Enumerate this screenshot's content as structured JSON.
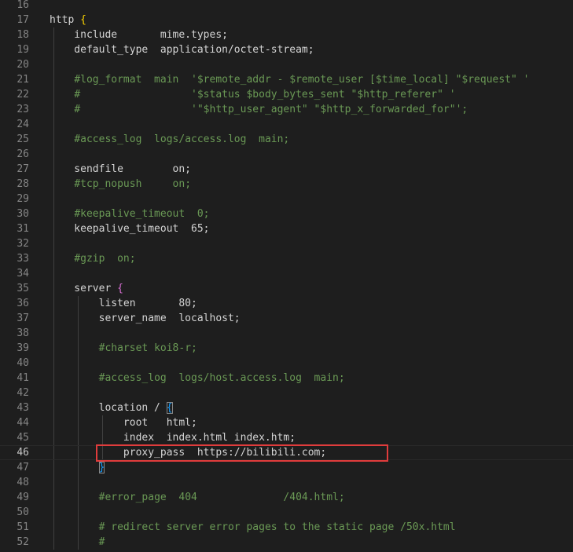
{
  "editor": {
    "lines": [
      {
        "n": "16",
        "segments": []
      },
      {
        "n": "17",
        "segments": [
          {
            "t": "http "
          },
          {
            "t": "{",
            "c": "brace-gold"
          }
        ]
      },
      {
        "n": "18",
        "segments": [
          {
            "t": "    include       mime.types;"
          }
        ]
      },
      {
        "n": "19",
        "segments": [
          {
            "t": "    default_type  application/octet-stream;"
          }
        ]
      },
      {
        "n": "20",
        "segments": []
      },
      {
        "n": "21",
        "segments": [
          {
            "t": "    "
          },
          {
            "t": "#log_format  main  '$remote_addr - $remote_user [$time_local] \"$request\" '",
            "c": "comment"
          }
        ]
      },
      {
        "n": "22",
        "segments": [
          {
            "t": "    "
          },
          {
            "t": "#                  '$status $body_bytes_sent \"$http_referer\" '",
            "c": "comment"
          }
        ]
      },
      {
        "n": "23",
        "segments": [
          {
            "t": "    "
          },
          {
            "t": "#                  '\"$http_user_agent\" \"$http_x_forwarded_for\"';",
            "c": "comment"
          }
        ]
      },
      {
        "n": "24",
        "segments": []
      },
      {
        "n": "25",
        "segments": [
          {
            "t": "    "
          },
          {
            "t": "#access_log  logs/access.log  main;",
            "c": "comment"
          }
        ]
      },
      {
        "n": "26",
        "segments": []
      },
      {
        "n": "27",
        "segments": [
          {
            "t": "    sendfile        on;"
          }
        ]
      },
      {
        "n": "28",
        "segments": [
          {
            "t": "    "
          },
          {
            "t": "#tcp_nopush     on;",
            "c": "comment"
          }
        ]
      },
      {
        "n": "29",
        "segments": []
      },
      {
        "n": "30",
        "segments": [
          {
            "t": "    "
          },
          {
            "t": "#keepalive_timeout  0;",
            "c": "comment"
          }
        ]
      },
      {
        "n": "31",
        "segments": [
          {
            "t": "    keepalive_timeout  65;"
          }
        ]
      },
      {
        "n": "32",
        "segments": []
      },
      {
        "n": "33",
        "segments": [
          {
            "t": "    "
          },
          {
            "t": "#gzip  on;",
            "c": "comment"
          }
        ]
      },
      {
        "n": "34",
        "segments": []
      },
      {
        "n": "35",
        "segments": [
          {
            "t": "    server "
          },
          {
            "t": "{",
            "c": "brace-purple"
          }
        ]
      },
      {
        "n": "36",
        "segments": [
          {
            "t": "        listen       80;"
          }
        ]
      },
      {
        "n": "37",
        "segments": [
          {
            "t": "        server_name  localhost;"
          }
        ]
      },
      {
        "n": "38",
        "segments": []
      },
      {
        "n": "39",
        "segments": [
          {
            "t": "        "
          },
          {
            "t": "#charset koi8-r;",
            "c": "comment"
          }
        ]
      },
      {
        "n": "40",
        "segments": []
      },
      {
        "n": "41",
        "segments": [
          {
            "t": "        "
          },
          {
            "t": "#access_log  logs/host.access.log  main;",
            "c": "comment"
          }
        ]
      },
      {
        "n": "42",
        "segments": []
      },
      {
        "n": "43",
        "segments": [
          {
            "t": "        location / "
          },
          {
            "t": "{",
            "c": "brace-blue brace-box"
          }
        ]
      },
      {
        "n": "44",
        "segments": [
          {
            "t": "            root   html;"
          }
        ]
      },
      {
        "n": "45",
        "segments": [
          {
            "t": "            index  index.html index.htm;"
          }
        ]
      },
      {
        "n": "46",
        "segments": [
          {
            "t": "            proxy_pass  https://bilibili.com;"
          }
        ],
        "current": true
      },
      {
        "n": "47",
        "segments": [
          {
            "t": "        "
          },
          {
            "t": "}",
            "c": "brace-blue brace-box"
          }
        ]
      },
      {
        "n": "48",
        "segments": []
      },
      {
        "n": "49",
        "segments": [
          {
            "t": "        "
          },
          {
            "t": "#error_page  404              /404.html;",
            "c": "comment"
          }
        ]
      },
      {
        "n": "50",
        "segments": []
      },
      {
        "n": "51",
        "segments": [
          {
            "t": "        "
          },
          {
            "t": "# redirect server error pages to the static page /50x.html",
            "c": "comment"
          }
        ]
      },
      {
        "n": "52",
        "segments": [
          {
            "t": "        "
          },
          {
            "t": "#",
            "c": "comment"
          }
        ]
      }
    ],
    "colors": {
      "background": "#1e1e1e",
      "text": "#d4d4d4",
      "comment": "#6a9955",
      "line_number": "#858585",
      "highlight_box": "#e03c3c"
    }
  }
}
